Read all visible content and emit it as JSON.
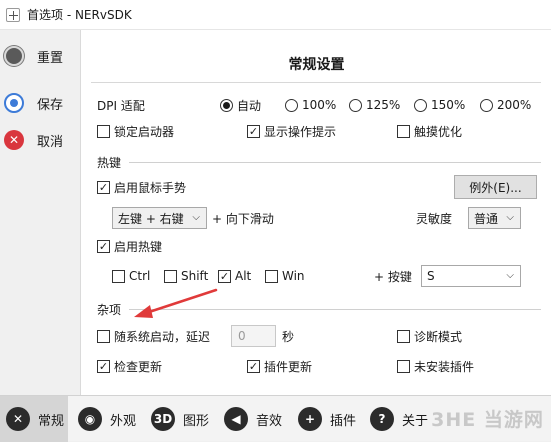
{
  "window": {
    "title": "首选项 - NERvSDK"
  },
  "sidebar": {
    "reset": "重置",
    "save": "保存",
    "cancel": "取消"
  },
  "panel": {
    "title": "常规设置",
    "dpi": {
      "label": "DPI 适配",
      "options": [
        "自动",
        "100%",
        "125%",
        "150%",
        "200%"
      ],
      "selected": "自动"
    },
    "general_checks": [
      {
        "label": "锁定启动器",
        "checked": false
      },
      {
        "label": "显示操作提示",
        "checked": true
      },
      {
        "label": "触摸优化",
        "checked": false
      }
    ],
    "hotkey": {
      "section": "热键",
      "mouse_gesture": {
        "label": "启用鼠标手势",
        "checked": true
      },
      "exceptions_button": "例外(E)...",
      "gesture_combo": "左键 + 右键",
      "gesture_action": "+ 向下滑动",
      "sensitivity_label": "灵敏度",
      "sensitivity_value": "普通",
      "enable_hotkey": {
        "label": "启用热键",
        "checked": true
      },
      "modifiers": [
        {
          "label": "Ctrl",
          "checked": false
        },
        {
          "label": "Shift",
          "checked": false
        },
        {
          "label": "Alt",
          "checked": true
        },
        {
          "label": "Win",
          "checked": false
        }
      ],
      "key_label": "+ 按键",
      "key_value": "S"
    },
    "misc": {
      "section": "杂项",
      "autostart": {
        "label": "随系统启动，延迟",
        "checked": false
      },
      "delay_value": "0",
      "delay_unit": "秒",
      "diagnostic": {
        "label": "诊断模式",
        "checked": false
      },
      "check_update": {
        "label": "检查更新",
        "checked": true
      },
      "plugin_update": {
        "label": "插件更新",
        "checked": true
      },
      "uninstalled_plugins": {
        "label": "未安装插件",
        "checked": false
      }
    }
  },
  "tabs": [
    {
      "label": "常规",
      "icon": "wrench-icon",
      "glyph": "✕"
    },
    {
      "label": "外观",
      "icon": "eye-icon",
      "glyph": "◉"
    },
    {
      "label": "图形",
      "icon": "3d-icon",
      "glyph": "3D"
    },
    {
      "label": "音效",
      "icon": "speaker-icon",
      "glyph": "◀"
    },
    {
      "label": "插件",
      "icon": "plus-icon",
      "glyph": "+"
    },
    {
      "label": "关于",
      "icon": "question-icon",
      "glyph": "?"
    }
  ],
  "watermark": "3HE 当游网",
  "colors": {
    "annotation_arrow": "#e03a3a",
    "save_blue": "#3d7bd8",
    "cancel_red": "#d9363e"
  }
}
